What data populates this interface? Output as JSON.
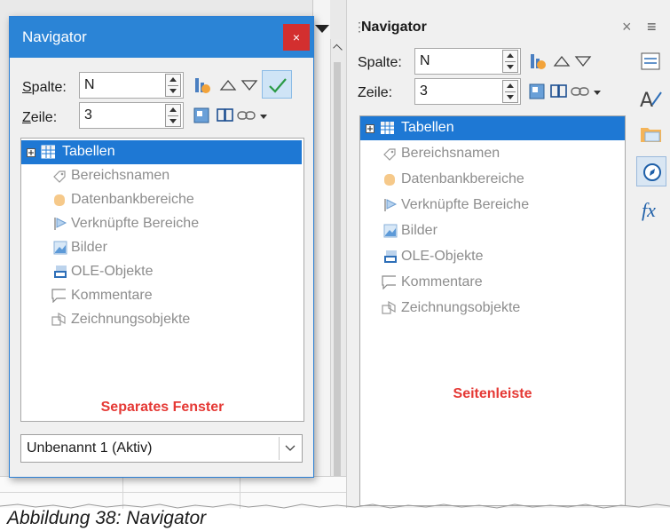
{
  "floating_window": {
    "title": "Navigator",
    "close_glyph": "×",
    "column_label": "Spalte:",
    "column_value": "N",
    "row_label": "Zeile:",
    "row_value": "3",
    "items": [
      {
        "label": "Tabellen",
        "icon": "table-icon",
        "selected": true
      },
      {
        "label": "Bereichsnamen",
        "icon": "range-name-icon"
      },
      {
        "label": "Datenbankbereiche",
        "icon": "database-range-icon"
      },
      {
        "label": "Verknüpfte Bereiche",
        "icon": "linked-area-icon"
      },
      {
        "label": "Bilder",
        "icon": "image-icon"
      },
      {
        "label": "OLE-Objekte",
        "icon": "ole-object-icon"
      },
      {
        "label": "Kommentare",
        "icon": "comment-icon"
      },
      {
        "label": "Zeichnungsobjekte",
        "icon": "drawing-object-icon"
      }
    ],
    "note": "Separates Fenster",
    "document_select": "Unbenannt 1 (Aktiv)"
  },
  "sidebar": {
    "title": "Navigator",
    "close_glyph": "×",
    "menu_glyph": "≡",
    "column_label": "Spalte:",
    "column_value": "N",
    "row_label": "Zeile:",
    "row_value": "3",
    "items": [
      {
        "label": "Tabellen",
        "icon": "table-icon",
        "selected": true
      },
      {
        "label": "Bereichsnamen",
        "icon": "range-name-icon"
      },
      {
        "label": "Datenbankbereiche",
        "icon": "database-range-icon"
      },
      {
        "label": "Verknüpfte Bereiche",
        "icon": "linked-area-icon"
      },
      {
        "label": "Bilder",
        "icon": "image-icon"
      },
      {
        "label": "OLE-Objekte",
        "icon": "ole-object-icon"
      },
      {
        "label": "Kommentare",
        "icon": "comment-icon"
      },
      {
        "label": "Zeichnungsobjekte",
        "icon": "drawing-object-icon"
      }
    ],
    "note": "Seitenleiste",
    "deck_icons": [
      "properties-icon",
      "styles-icon",
      "gallery-icon",
      "navigator-icon",
      "functions-icon"
    ],
    "functions_glyph": "fx"
  },
  "caption": "Abbildung 38: Navigator",
  "colors": {
    "accent": "#1e78d4",
    "titlebar": "#2b84d6",
    "note": "#e53935",
    "close": "#d32f2f"
  }
}
